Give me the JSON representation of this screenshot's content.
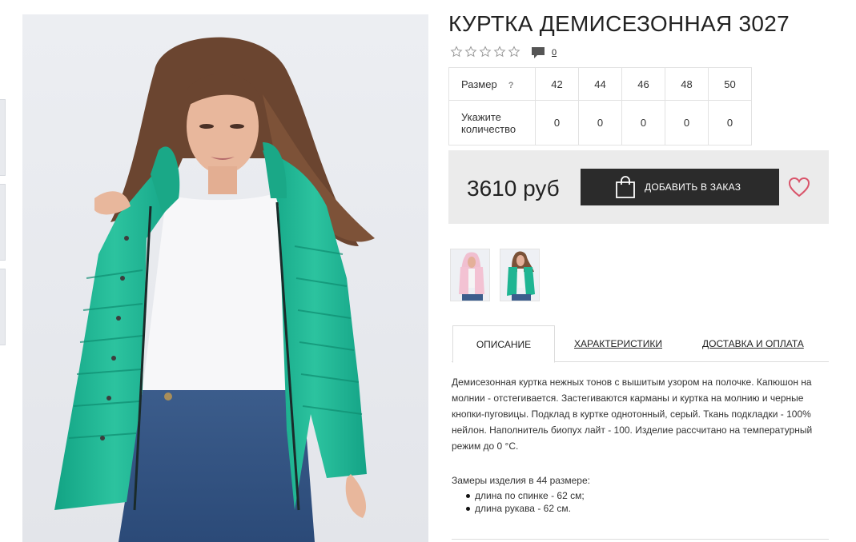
{
  "product": {
    "title": "КУРТКА ДЕМИСЕЗОННАЯ 3027",
    "rating_stars": 0,
    "rating_max": 5,
    "comments_count": "0",
    "price": "3610 руб",
    "add_to_order_label": "ДОБАВИТЬ В ЗАКАЗ"
  },
  "size_table": {
    "size_label": "Размер",
    "help_mark": "?",
    "sizes": [
      "42",
      "44",
      "46",
      "48",
      "50"
    ],
    "quantity_label": "Укажите количество",
    "quantities": [
      "0",
      "0",
      "0",
      "0",
      "0"
    ]
  },
  "tabs": [
    {
      "label": "ОПИСАНИЕ",
      "active": true
    },
    {
      "label": "ХАРАКТЕРИСТИКИ",
      "active": false
    },
    {
      "label": "ДОСТАВКА И ОПЛАТА",
      "active": false
    }
  ],
  "description": {
    "text": "Демисезонная куртка нежных тонов с вышитым узором на полочке. Капюшон на молнии - отстегивается. Застегиваются карманы и куртка на молнию и черные кнопки-пуговицы. Подклад в куртке однотонный, серый. Ткань подкладки - 100% нейлон. Наполнитель биопух лайт - 100. Изделие рассчитано на температурный режим до 0 °C.",
    "measures_title": "Замеры изделия в 44 размере:",
    "measures": [
      "длина по спинке - 62 см;",
      "длина рукава - 62 см."
    ]
  },
  "colors": {
    "button_bg": "#2b2b2b",
    "buy_box_bg": "#ebebeb",
    "heart": "#d9546a",
    "jacket_mint": "#1fb592",
    "jacket_pink": "#f3c2d3"
  },
  "icons": [
    "star-icon",
    "comment-icon",
    "shopping-bag-icon",
    "heart-icon"
  ]
}
